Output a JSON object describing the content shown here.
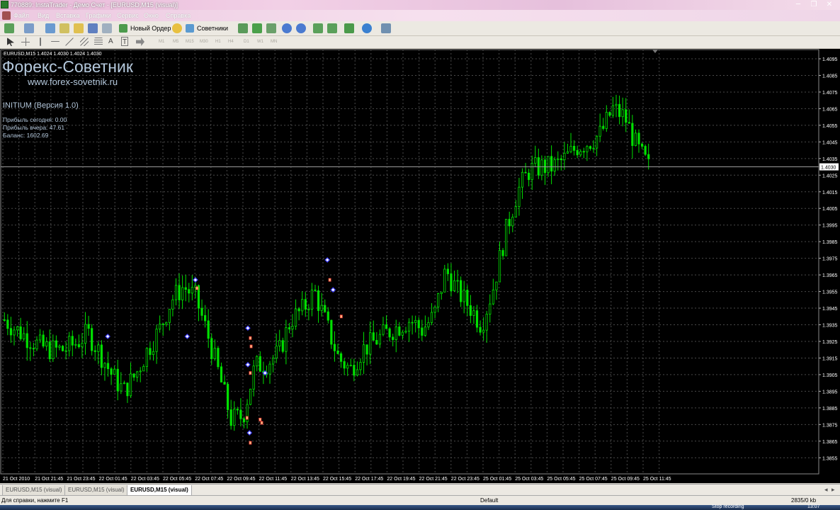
{
  "window": {
    "title": "770889: InstaTrader - Демо Счет - [EURUSD,M15 (visual)]",
    "controls": [
      "─",
      "❐",
      "✕"
    ]
  },
  "menu": [
    "Файл",
    "Вид",
    "Вставка",
    "Графики",
    "Сервис",
    "Окно",
    "Справка"
  ],
  "toolbar": {
    "new_order_label": "Новый Ордер",
    "experts_label": "Советники",
    "timeframes": [
      "M1",
      "M5",
      "M15",
      "M30",
      "H1",
      "H4",
      "D1",
      "W1",
      "MN"
    ]
  },
  "chart": {
    "header": "EURUSD,M15  1.4024 1.4030 1.4024 1.4030",
    "overlay_title": "Форекс-Советник",
    "overlay_url": "www.forex-sovetnik.ru",
    "ea_name": "INITIUM (Версия 1.0)",
    "stats": [
      "Прибыль сегодня: 0.00",
      "Прибыль вчера: 47.61",
      "Баланс: 1602.69"
    ],
    "current_price": "1.4030",
    "colors": {
      "background": "#000000",
      "grid": "#4a4a4a",
      "candle": "#00e000",
      "text": "#ffffff",
      "overlay": "#b4c8dc",
      "marker_buy": "#4040ff",
      "marker_sell": "#ff4040"
    }
  },
  "chart_data": {
    "type": "candlestick",
    "symbol": "EURUSD",
    "timeframe": "M15",
    "ylim": [
      1.385,
      1.4095
    ],
    "y_ticks": [
      "1.4095",
      "1.4085",
      "1.4075",
      "1.4065",
      "1.4055",
      "1.4045",
      "1.4035",
      "1.4025",
      "1.4015",
      "1.4005",
      "1.3995",
      "1.3985",
      "1.3975",
      "1.3965",
      "1.3955",
      "1.3945",
      "1.3935",
      "1.3925",
      "1.3915",
      "1.3905",
      "1.3895",
      "1.3885",
      "1.3875",
      "1.3865",
      "1.3855"
    ],
    "x_ticks": [
      "21 Oct 2010",
      "21 Oct 21:45",
      "21 Oct 23:45",
      "22 Oct 01:45",
      "22 Oct 03:45",
      "22 Oct 05:45",
      "22 Oct 07:45",
      "22 Oct 09:45",
      "22 Oct 11:45",
      "22 Oct 13:45",
      "22 Oct 15:45",
      "22 Oct 17:45",
      "22 Oct 19:45",
      "22 Oct 21:45",
      "22 Oct 23:45",
      "25 Oct 01:45",
      "25 Oct 03:45",
      "25 Oct 05:45",
      "25 Oct 07:45",
      "25 Oct 09:45",
      "25 Oct 11:45"
    ],
    "close_path": [
      1.3938,
      1.3932,
      1.3927,
      1.3922,
      1.392,
      1.392,
      1.3924,
      1.393,
      1.3918,
      1.3905,
      1.3895,
      1.3905,
      1.392,
      1.3932,
      1.395,
      1.3958,
      1.3952,
      1.393,
      1.3905,
      1.3878,
      1.388,
      1.391,
      1.3912,
      1.3918,
      1.3938,
      1.3944,
      1.3955,
      1.3935,
      1.3915,
      1.3908,
      1.392,
      1.3925,
      1.393,
      1.3934,
      1.3938,
      1.3932,
      1.394,
      1.3968,
      1.3955,
      1.3946,
      1.3935,
      1.3958,
      1.399,
      1.4015,
      1.4028,
      1.403,
      1.403,
      1.4035,
      1.4042,
      1.4045,
      1.405,
      1.4065,
      1.406,
      1.4042,
      1.403
    ],
    "markers": [
      {
        "x_frac": 0.128,
        "price": 1.3928,
        "kind": "buy"
      },
      {
        "x_frac": 0.235,
        "price": 1.3962,
        "kind": "buy"
      },
      {
        "x_frac": 0.237,
        "price": 1.3957,
        "kind": "sell"
      },
      {
        "x_frac": 0.225,
        "price": 1.3928,
        "kind": "buy"
      },
      {
        "x_frac": 0.299,
        "price": 1.3933,
        "kind": "buy"
      },
      {
        "x_frac": 0.302,
        "price": 1.3927,
        "kind": "sell"
      },
      {
        "x_frac": 0.303,
        "price": 1.3922,
        "kind": "sell"
      },
      {
        "x_frac": 0.299,
        "price": 1.3911,
        "kind": "buy"
      },
      {
        "x_frac": 0.302,
        "price": 1.3906,
        "kind": "sell"
      },
      {
        "x_frac": 0.298,
        "price": 1.3879,
        "kind": "sell"
      },
      {
        "x_frac": 0.314,
        "price": 1.3878,
        "kind": "sell"
      },
      {
        "x_frac": 0.316,
        "price": 1.3876,
        "kind": "sell"
      },
      {
        "x_frac": 0.301,
        "price": 1.387,
        "kind": "buy"
      },
      {
        "x_frac": 0.302,
        "price": 1.3864,
        "kind": "sell"
      },
      {
        "x_frac": 0.32,
        "price": 1.3906,
        "kind": "buy"
      },
      {
        "x_frac": 0.396,
        "price": 1.3974,
        "kind": "buy"
      },
      {
        "x_frac": 0.399,
        "price": 1.3962,
        "kind": "sell"
      },
      {
        "x_frac": 0.403,
        "price": 1.3956,
        "kind": "buy"
      },
      {
        "x_frac": 0.413,
        "price": 1.394,
        "kind": "sell"
      }
    ]
  },
  "tabs": [
    "EURUSD,M15 (visual)",
    "EURUSD,M15 (visual)",
    "EURUSD,M15 (visual)"
  ],
  "status": {
    "help": "Для справки, нажмите F1",
    "profile": "Default",
    "traffic": "2835/0 kb"
  },
  "taskbar": {
    "stop_recording": "Stop recording",
    "clock": "13:07"
  }
}
